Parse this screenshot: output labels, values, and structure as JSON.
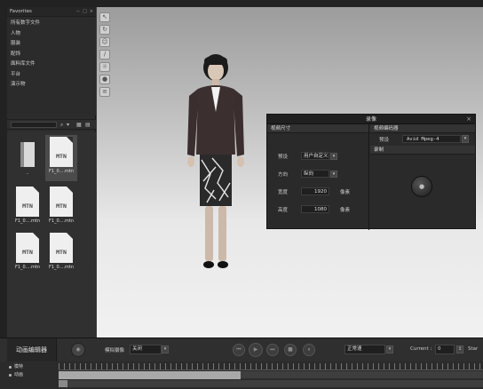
{
  "favorites": {
    "title": "Favorites",
    "controls": [
      "−",
      "□",
      "×"
    ],
    "items": [
      "所有数字文件",
      "人物",
      "服装",
      "配饰",
      "面料库文件",
      "平台",
      "演示物"
    ]
  },
  "file_toolbar": {
    "search_icon": "⌕",
    "buttons": [
      "▾",
      "▦",
      "▤"
    ]
  },
  "files": [
    {
      "icon": "folder-icon",
      "badge": "",
      "name": "..",
      "selected": false
    },
    {
      "icon": "file-icon",
      "badge": "MTN",
      "name": "F1_0....mtn",
      "selected": true
    },
    {
      "icon": "file-icon",
      "badge": "MTN",
      "name": "F1_0....mtn",
      "selected": false
    },
    {
      "icon": "file-icon",
      "badge": "MTN",
      "name": "F1_0....mtn",
      "selected": false
    },
    {
      "icon": "file-icon",
      "badge": "MTN",
      "name": "F1_0....mtn",
      "selected": false
    },
    {
      "icon": "file-icon",
      "badge": "MTN",
      "name": "F1_0....mtn",
      "selected": false
    }
  ],
  "viewport_tools": [
    "cursor-icon",
    "rotate-icon",
    "pose-icon",
    "brush-icon",
    "light-icon",
    "sphere-icon",
    "layers-icon"
  ],
  "dialog": {
    "title": "录像",
    "close": "×",
    "size_section": "视频尺寸",
    "rows": {
      "preset_label": "预设",
      "preset_value": "用户自定义",
      "direction_label": "方向",
      "direction_value": "纵向",
      "width_label": "宽度",
      "width_value": "1920",
      "width_unit": "像素",
      "height_label": "高度",
      "height_value": "1080",
      "height_unit": "像素"
    },
    "encoder_section": "视频编码器",
    "encoder_label": "预设",
    "encoder_value": "Avid Mpeg-4",
    "record_section": "录制",
    "record_glyph": "●"
  },
  "bottom": {
    "title": "动画编辑器",
    "camera_label": "模拟摄像",
    "camera_value": "关闭",
    "speed_value": "正常速",
    "current_label": "Current :",
    "current_value": "0",
    "start_label": "Star",
    "playback": [
      "⏮",
      "▶",
      "⏭",
      "■",
      "⏸"
    ],
    "tracks": [
      "模特",
      "动画"
    ]
  },
  "colors": {
    "viewport_top": "#9c9c9c",
    "viewport_bottom": "#f1f1f1",
    "panel_bg": "#2c2c2c"
  }
}
